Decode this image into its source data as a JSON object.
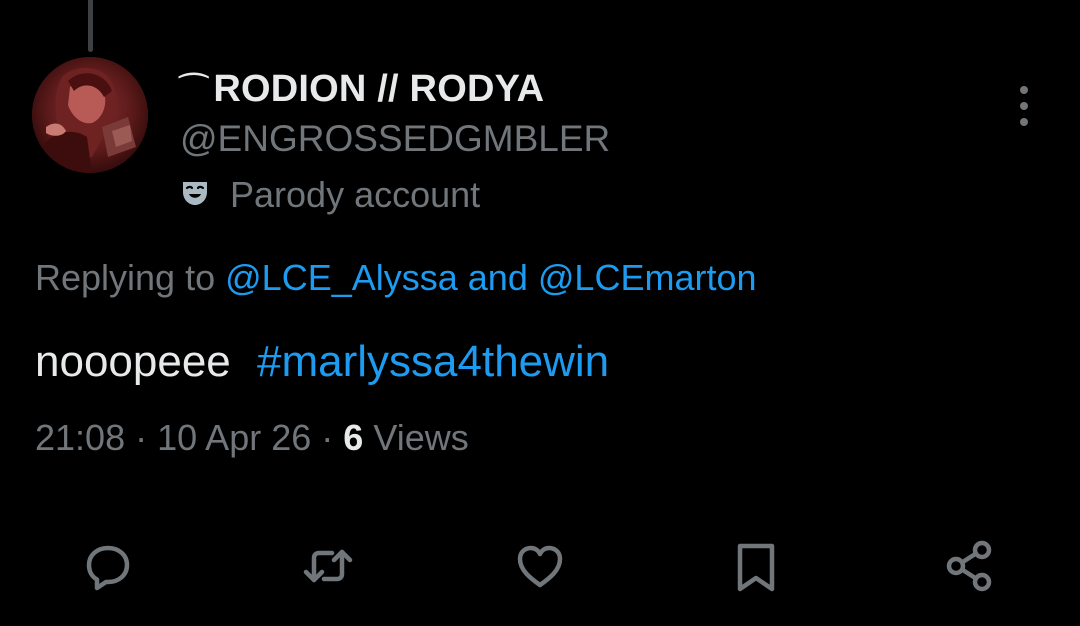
{
  "tweet": {
    "author": {
      "name_ornament": "⁀",
      "display_name": "RODION // RODYA",
      "handle": "@ENGROSSEDGMBLER",
      "account_label": "Parody account",
      "account_label_icon": "theater-mask-icon"
    },
    "replying": {
      "prefix": "Replying to",
      "first_mention": "@LCE_Alyssa",
      "conjunction": "and",
      "second_mention": "@LCEmarton"
    },
    "body": {
      "text": "nooopeee",
      "hashtag": "#marlyssa4thewin"
    },
    "meta": {
      "time": "21:08",
      "separator": "·",
      "date": "10 Apr 26",
      "views_count": "6",
      "views_label": "Views"
    },
    "actions": [
      {
        "name": "reply",
        "icon": "reply-bubble-icon"
      },
      {
        "name": "repost",
        "icon": "repost-arrows-icon"
      },
      {
        "name": "like",
        "icon": "heart-icon"
      },
      {
        "name": "bookmark",
        "icon": "bookmark-icon"
      },
      {
        "name": "share",
        "icon": "share-icon"
      }
    ]
  },
  "colors": {
    "background": "#000000",
    "primary_text": "#e7e9ea",
    "secondary_text": "#71767b",
    "accent_link": "#1d9bf0",
    "thread_line": "#3e4144"
  }
}
